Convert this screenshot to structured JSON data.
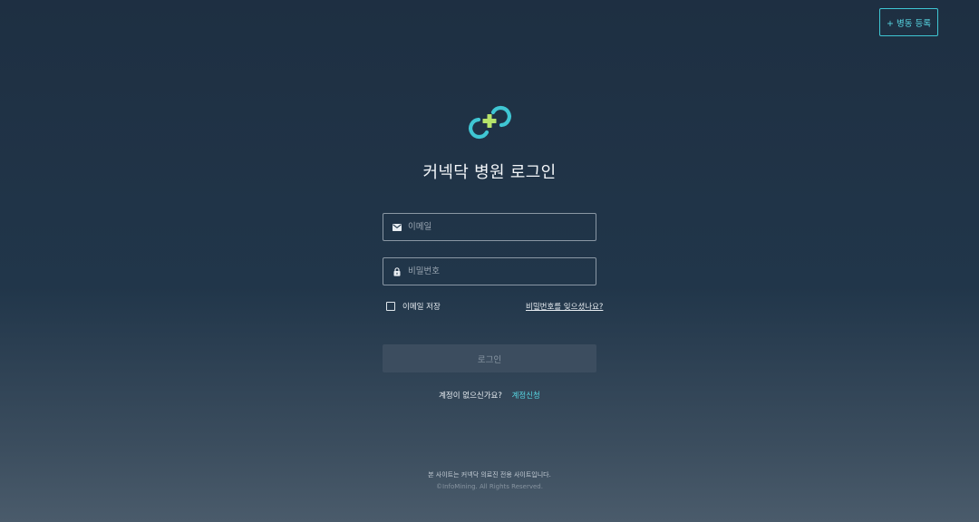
{
  "header": {
    "ward_register_label": "+ 병동 등록"
  },
  "login": {
    "title": "커넥닥 병원 로그인",
    "email_placeholder": "이메일",
    "password_placeholder": "비밀번호",
    "remember_label": "이메일 저장",
    "forgot_label": "비밀번호를 잊으셨나요?",
    "submit_label": "로그인",
    "signup_question": "계정이 없으신가요?",
    "signup_link": "계정신청"
  },
  "footer": {
    "notice": "본 사이트는 커넥닥 의료진 전용 사이트입니다.",
    "copyright": "©InfoMining. All Rights Reserved."
  },
  "colors": {
    "accent": "#57d6e2",
    "logo_green": "#b6e36a",
    "background_top": "#1e2f42",
    "background_bottom": "#4a5b6b",
    "button_disabled": "#3c4d5f"
  },
  "icons": {
    "logo": "connectdoc-logo-icon",
    "email": "mail-icon",
    "password": "lock-icon"
  }
}
